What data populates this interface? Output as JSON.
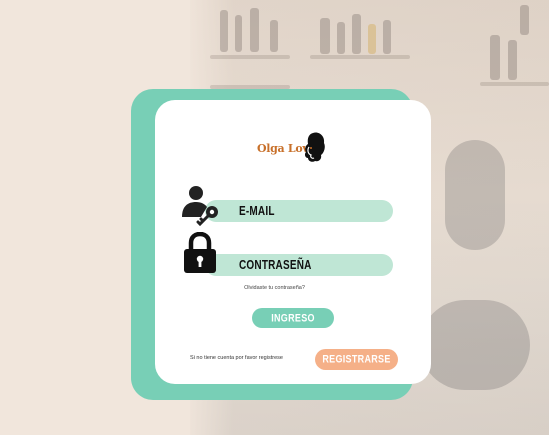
{
  "brand": {
    "logo_text": "Olga Lova"
  },
  "form": {
    "email_label": "E-MAIL",
    "password_label": "CONTRASEÑA",
    "forgot_text": "Olvidaste tu contraseña?",
    "login_button": "INGRESO",
    "register_hint": "Si no tiene cuenta por favor registrese",
    "register_button": "REGISTRARSE"
  },
  "icons": {
    "email": "user-key-icon",
    "password": "padlock-icon"
  },
  "colors": {
    "background": "#f1e6dc",
    "accent_green": "#78cfb6",
    "field_green": "#bfe6d5",
    "accent_orange": "#f5b088",
    "logo_orange": "#c8702a"
  }
}
